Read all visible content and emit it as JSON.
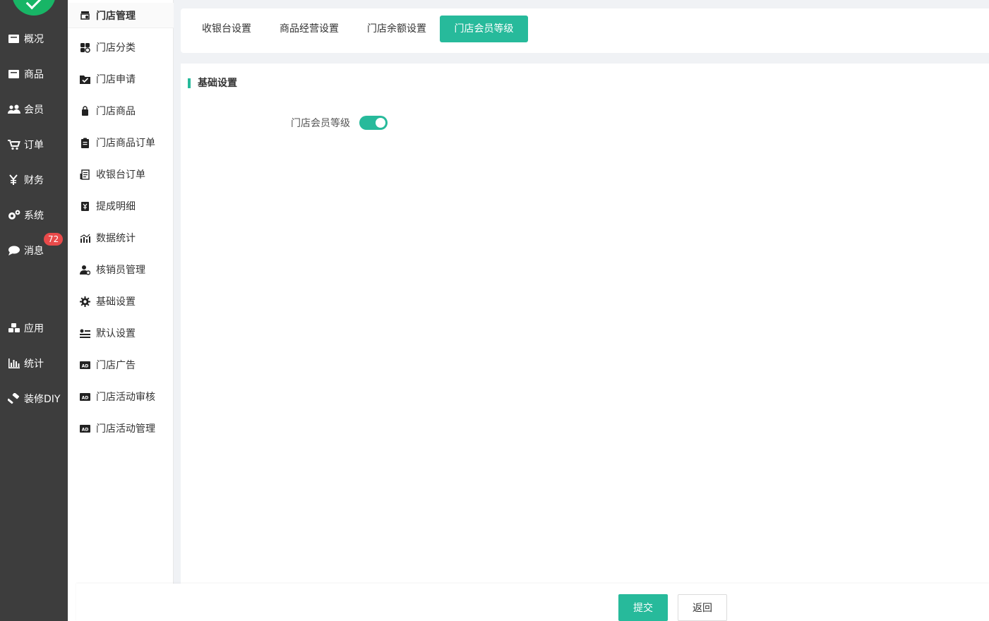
{
  "main_nav": {
    "items": [
      {
        "label": "概况",
        "icon": "dashboard-icon"
      },
      {
        "label": "商品",
        "icon": "goods-icon"
      },
      {
        "label": "会员",
        "icon": "members-icon"
      },
      {
        "label": "订单",
        "icon": "cart-icon"
      },
      {
        "label": "财务",
        "icon": "yen-icon"
      },
      {
        "label": "系统",
        "icon": "gears-icon"
      },
      {
        "label": "消息",
        "icon": "chat-icon"
      },
      {
        "label": "应用",
        "icon": "cubes-icon"
      },
      {
        "label": "统计",
        "icon": "bar-chart-icon"
      },
      {
        "label": "装修DIY",
        "icon": "hammer-icon"
      }
    ],
    "message_badge": "72"
  },
  "sub_nav": {
    "header": "门店管理",
    "items": [
      {
        "label": "门店分类"
      },
      {
        "label": "门店申请"
      },
      {
        "label": "门店商品"
      },
      {
        "label": "门店商品订单"
      },
      {
        "label": "收银台订单"
      },
      {
        "label": "提成明细"
      },
      {
        "label": "数据统计"
      },
      {
        "label": "核销员管理"
      },
      {
        "label": "基础设置"
      },
      {
        "label": "默认设置"
      },
      {
        "label": "门店广告"
      },
      {
        "label": "门店活动审核"
      },
      {
        "label": "门店活动管理"
      }
    ]
  },
  "tabs": [
    {
      "label": "收银台设置"
    },
    {
      "label": "商品经营设置"
    },
    {
      "label": "门店余额设置"
    },
    {
      "label": "门店会员等级"
    }
  ],
  "active_tab": "门店会员等级",
  "section": {
    "title": "基础设置",
    "setting_label": "门店会员等级",
    "switch_on": true
  },
  "footer": {
    "submit_label": "提交",
    "back_label": "返回"
  },
  "colors": {
    "primary": "#27ba9b",
    "nav_bg": "#3d3d3d",
    "badge": "#e94a4a",
    "logo": "#18b566"
  }
}
